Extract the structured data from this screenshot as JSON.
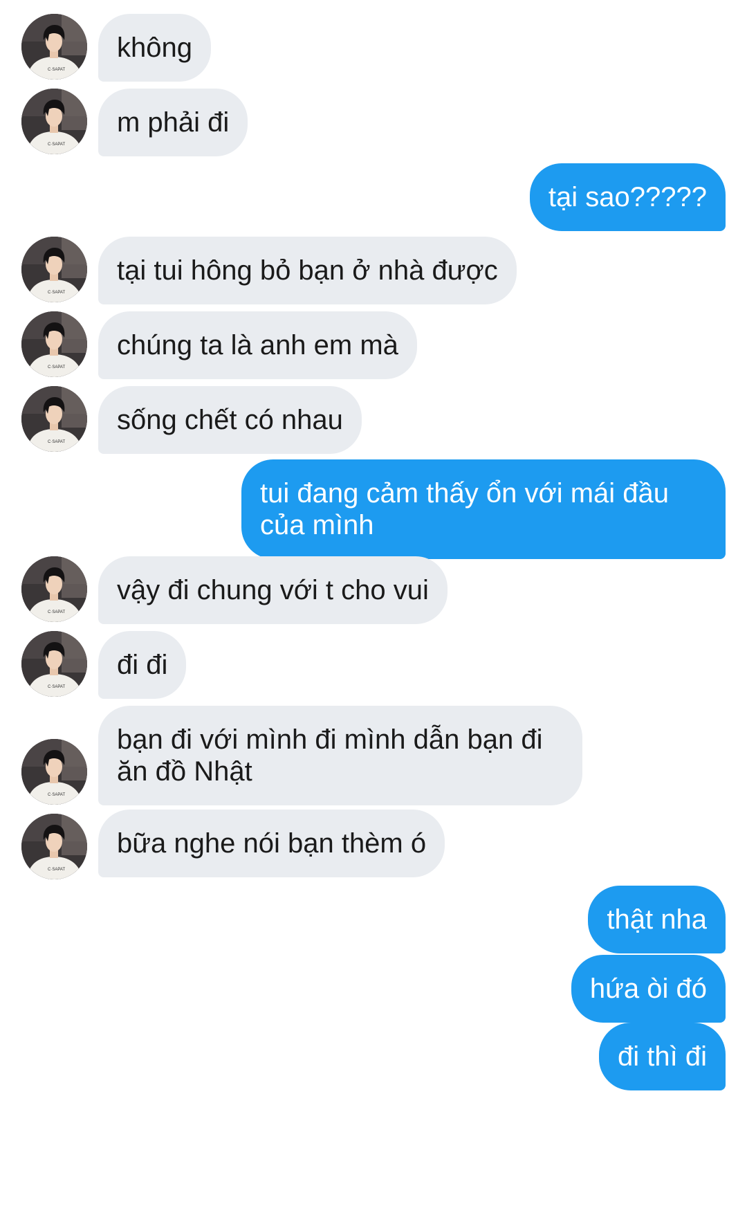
{
  "thread": {
    "messages": [
      {
        "side": "in",
        "text": "không"
      },
      {
        "side": "in",
        "text": "m phải đi"
      },
      {
        "side": "out",
        "text": "tại sao?????"
      },
      {
        "side": "in",
        "text": "tại tui hông bỏ bạn ở nhà được"
      },
      {
        "side": "in",
        "text": "chúng ta là anh em mà"
      },
      {
        "side": "in",
        "text": "sống chết có nhau"
      },
      {
        "side": "out",
        "text": "tui đang cảm thấy ổn với mái đầu của mình"
      },
      {
        "side": "in",
        "text": "vậy đi chung với t cho vui"
      },
      {
        "side": "in",
        "text": "đi đi"
      },
      {
        "side": "in",
        "text": "bạn đi với mình đi mình dẫn bạn đi ăn đồ Nhật"
      },
      {
        "side": "in",
        "text": "bữa nghe nói bạn thèm ó"
      },
      {
        "side": "out",
        "text": "thật nha"
      },
      {
        "side": "out",
        "text": "hứa òi đó"
      },
      {
        "side": "out",
        "text": "đi thì đi"
      }
    ]
  },
  "colors": {
    "incoming_bubble": "#e9ecf0",
    "outgoing_bubble": "#1d9bf0",
    "incoming_text": "#1a1a1a",
    "outgoing_text": "#ffffff"
  },
  "icons": {
    "avatar": "contact-avatar-icon"
  }
}
